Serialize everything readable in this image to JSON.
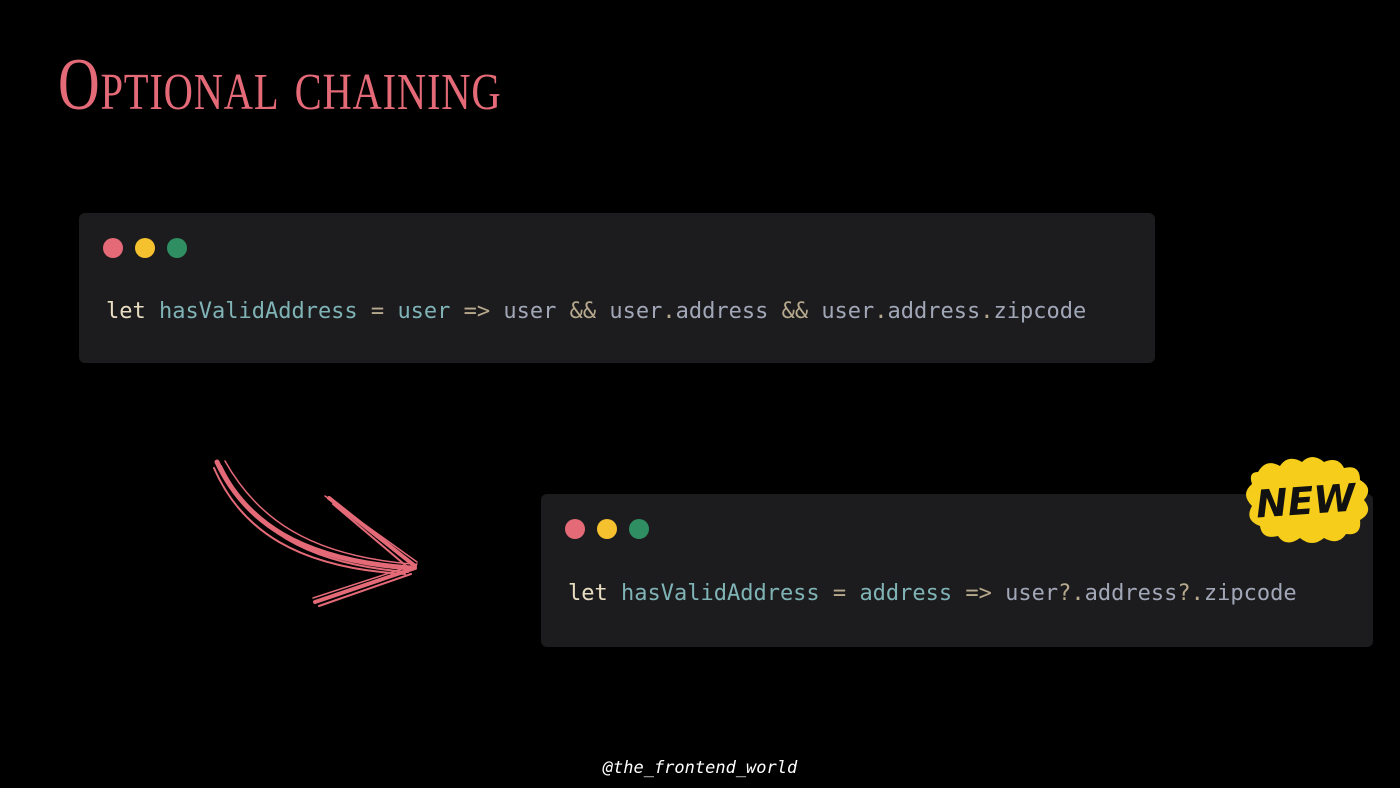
{
  "title": "Optional chaining",
  "colors": {
    "background": "#000000",
    "title": "#e46a78",
    "window": "#1c1c1e",
    "dot_red": "#e46a78",
    "dot_yellow": "#f6c12f",
    "dot_green": "#2f8f63",
    "badge_fill": "#f5cd1a",
    "badge_text": "#111111",
    "arrow": "#e46a78"
  },
  "window_controls": [
    "red-dot",
    "yellow-dot",
    "green-dot"
  ],
  "old_snippet": {
    "tokens": [
      {
        "t": "let",
        "k": "keyword"
      },
      {
        "t": " ",
        "k": "plain"
      },
      {
        "t": "hasValidAddress",
        "k": "var"
      },
      {
        "t": " = ",
        "k": "op"
      },
      {
        "t": "user",
        "k": "var"
      },
      {
        "t": " => ",
        "k": "op"
      },
      {
        "t": "user",
        "k": "plain"
      },
      {
        "t": " && ",
        "k": "op"
      },
      {
        "t": "user",
        "k": "plain"
      },
      {
        "t": ".",
        "k": "op"
      },
      {
        "t": "address",
        "k": "plain"
      },
      {
        "t": " && ",
        "k": "op"
      },
      {
        "t": "user",
        "k": "plain"
      },
      {
        "t": ".",
        "k": "op"
      },
      {
        "t": "address",
        "k": "plain"
      },
      {
        "t": ".",
        "k": "op"
      },
      {
        "t": "zipcode",
        "k": "plain"
      }
    ]
  },
  "new_snippet": {
    "tokens": [
      {
        "t": "let",
        "k": "keyword"
      },
      {
        "t": " ",
        "k": "plain"
      },
      {
        "t": "hasValidAddress",
        "k": "var"
      },
      {
        "t": " = ",
        "k": "op"
      },
      {
        "t": "address",
        "k": "var"
      },
      {
        "t": " => ",
        "k": "op"
      },
      {
        "t": "user",
        "k": "plain"
      },
      {
        "t": "?.",
        "k": "op"
      },
      {
        "t": "address",
        "k": "plain"
      },
      {
        "t": "?.",
        "k": "op"
      },
      {
        "t": "zipcode",
        "k": "plain"
      }
    ]
  },
  "badge": {
    "label": "NEW"
  },
  "handle": "@the_frontend_world"
}
